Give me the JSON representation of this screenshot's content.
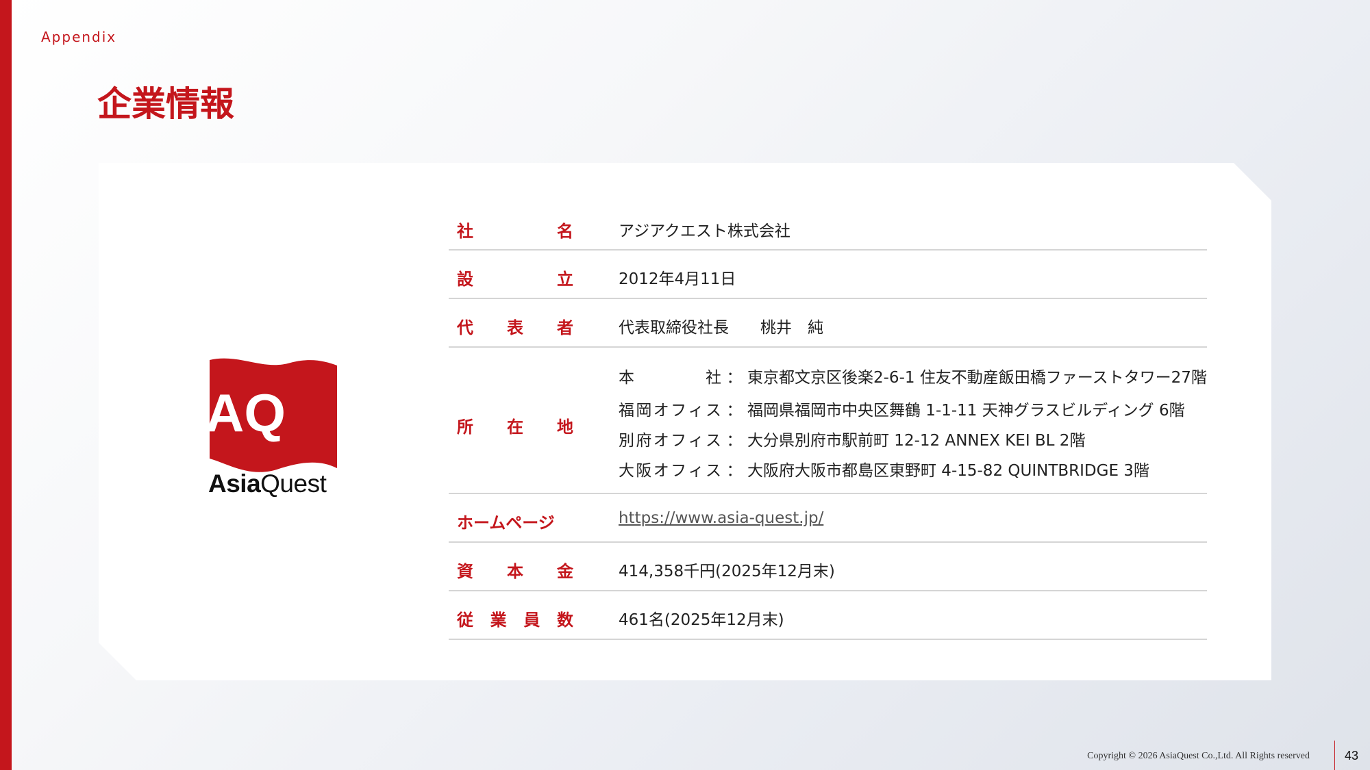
{
  "section_label": "Appendix",
  "title": "企業情報",
  "logo": {
    "mark": "AQ",
    "wordmark_bold": "Asia",
    "wordmark_light": "Quest",
    "brand_color": "#c4161c"
  },
  "rows": [
    {
      "label_chars": [
        "社",
        "名"
      ],
      "value": "アジアクエスト株式会社"
    },
    {
      "label_chars": [
        "設",
        "立"
      ],
      "value": "2012年4月11日"
    },
    {
      "label_chars": [
        "代",
        "表",
        "者"
      ],
      "value": "代表取締役社長　　桃井　純"
    },
    {
      "label_chars": [
        "所",
        "在",
        "地"
      ],
      "addresses": [
        {
          "key_chars": [
            "本",
            "社"
          ],
          "sep": "：",
          "value": "東京都文京区後楽2-6-1 住友不動産飯田橋ファーストタワー27階"
        },
        {
          "key_chars": [
            "福",
            "岡",
            "オ",
            "フ",
            "ィ",
            "ス"
          ],
          "sep": "：",
          "value": "福岡県福岡市中央区舞鶴 1-1-11 天神グラスビルディング 6階"
        },
        {
          "key_chars": [
            "別",
            "府",
            "オ",
            "フ",
            "ィ",
            "ス"
          ],
          "sep": "：",
          "value": "大分県別府市駅前町 12-12 ANNEX KEI BL 2階"
        },
        {
          "key_chars": [
            "大",
            "阪",
            "オ",
            "フ",
            "ィ",
            "ス"
          ],
          "sep": "：",
          "value": "大阪府大阪市都島区東野町 4-15-82 QUINTBRIDGE 3階"
        }
      ]
    },
    {
      "label": "ホームページ",
      "value": "https://www.asia-quest.jp/"
    },
    {
      "label_chars": [
        "資",
        "本",
        "金"
      ],
      "value": "414,358千円(2025年12月末)"
    },
    {
      "label_chars": [
        "従",
        "業",
        "員",
        "数"
      ],
      "value": "461名(2025年12月末)"
    }
  ],
  "footer": {
    "copyright": "Copyright © 2026 AsiaQuest Co.,Ltd. All Rights reserved",
    "page_number": "43"
  }
}
